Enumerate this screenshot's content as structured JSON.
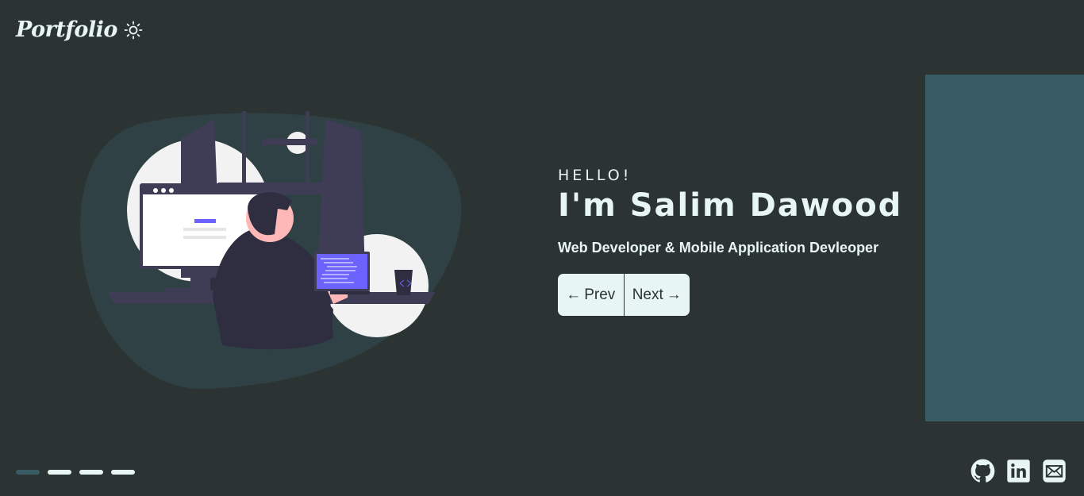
{
  "brand": {
    "logo_text": "Portfolio",
    "theme_icon": "sun-icon"
  },
  "hero": {
    "greeting": "HELLO!",
    "name": "I'm Salim Dawood",
    "subtitle": "Web Developer & Mobile Application Devleoper",
    "prev_label": "Prev",
    "next_label": "Next",
    "prev_icon": "←",
    "next_icon": "→"
  },
  "pager": {
    "count": 4,
    "active_index": 0
  },
  "socials": [
    {
      "name": "github",
      "icon": "github-icon"
    },
    {
      "name": "linkedin",
      "icon": "linkedin-icon"
    },
    {
      "name": "email",
      "icon": "mail-icon"
    }
  ],
  "colors": {
    "background": "#2c3333",
    "accent": "#395b64",
    "text": "#e7f6f2",
    "illustration_blob": "#2f4145",
    "illustration_purple": "#6c63ff",
    "illustration_dark": "#3f3d56"
  }
}
